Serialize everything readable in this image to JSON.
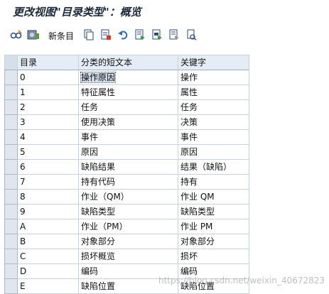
{
  "title": "更改视图\"目录类型\"：概览",
  "toolbar": {
    "new_entries_label": "新条目",
    "icons": [
      "glasses-edit-icon",
      "display-change-icon",
      "copy-icon",
      "delete-icon",
      "undo-icon",
      "select-all-icon",
      "select-block-icon",
      "deselect-all-icon",
      "print-icon"
    ]
  },
  "table": {
    "headers": [
      "目录",
      "分类的短文本",
      "关键字"
    ],
    "rows": [
      {
        "code": "0",
        "text": "操作原因",
        "keyword": "操作"
      },
      {
        "code": "1",
        "text": "特征属性",
        "keyword": "属性"
      },
      {
        "code": "2",
        "text": "任务",
        "keyword": "任务"
      },
      {
        "code": "3",
        "text": "使用决策",
        "keyword": "决策"
      },
      {
        "code": "4",
        "text": "事件",
        "keyword": "事件"
      },
      {
        "code": "5",
        "text": "原因",
        "keyword": "原因"
      },
      {
        "code": "6",
        "text": "缺陷结果",
        "keyword": "结果（缺陷）"
      },
      {
        "code": "7",
        "text": "持有代码",
        "keyword": "持有"
      },
      {
        "code": "8",
        "text": "作业（QM）",
        "keyword": "作业 QM"
      },
      {
        "code": "9",
        "text": "缺陷类型",
        "keyword": "缺陷类型"
      },
      {
        "code": "A",
        "text": "作业（PM）",
        "keyword": "作业 PM"
      },
      {
        "code": "B",
        "text": "对象部分",
        "keyword": "对象部分"
      },
      {
        "code": "C",
        "text": "损坏概览",
        "keyword": "损坏"
      },
      {
        "code": "D",
        "text": "编码",
        "keyword": "编码"
      },
      {
        "code": "E",
        "text": "缺陷位置",
        "keyword": "缺陷位置"
      }
    ]
  },
  "watermark": "https://blog.csdn.net/weixin_40672823"
}
